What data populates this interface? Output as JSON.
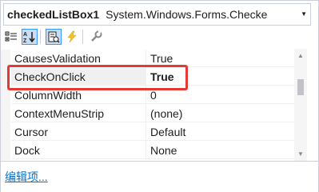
{
  "selector": {
    "object_name": "checkedListBox1",
    "object_type": "System.Windows.Forms.Checke"
  },
  "toolbar": {
    "buttons": [
      {
        "icon": "categorized-icon"
      },
      {
        "icon": "alphabetical-icon",
        "active": true
      },
      {
        "icon": "properties-icon",
        "active": true
      },
      {
        "icon": "events-icon"
      },
      {
        "icon": "property-pages-icon"
      }
    ]
  },
  "grid": {
    "rows": [
      {
        "name": "CausesValidation",
        "value": "True"
      },
      {
        "name": "CheckOnClick",
        "value": "True",
        "selected": true,
        "bold": true
      },
      {
        "name": "ColumnWidth",
        "value": "0"
      },
      {
        "name": "ContextMenuStrip",
        "value": "(none)"
      },
      {
        "name": "Cursor",
        "value": "Default"
      },
      {
        "name": "Dock",
        "value": "None"
      }
    ]
  },
  "commands": {
    "link_label": "编辑项..."
  },
  "colors": {
    "highlight": "#e53935",
    "link": "#0e70c0",
    "active_button": "#c9def5"
  }
}
